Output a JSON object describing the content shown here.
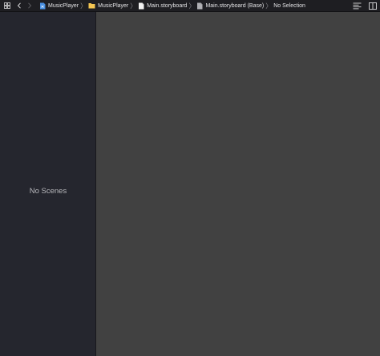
{
  "jumpbar": {
    "breadcrumbs": [
      {
        "label": "MusicPlayer",
        "icon": "xcode-project-icon"
      },
      {
        "label": "MusicPlayer",
        "icon": "folder-icon"
      },
      {
        "label": "Main.storyboard",
        "icon": "storyboard-file-icon"
      },
      {
        "label": "Main.storyboard (Base)",
        "icon": "storyboard-file-icon"
      },
      {
        "label": "No Selection",
        "icon": ""
      }
    ]
  },
  "outline": {
    "empty_label": "No Scenes"
  },
  "colors": {
    "toolbar_bg": "#1e1e22",
    "outline_bg": "#25262e",
    "canvas_bg": "#414141",
    "folder": "#f4c552",
    "project_icon": "#4a90e2"
  }
}
